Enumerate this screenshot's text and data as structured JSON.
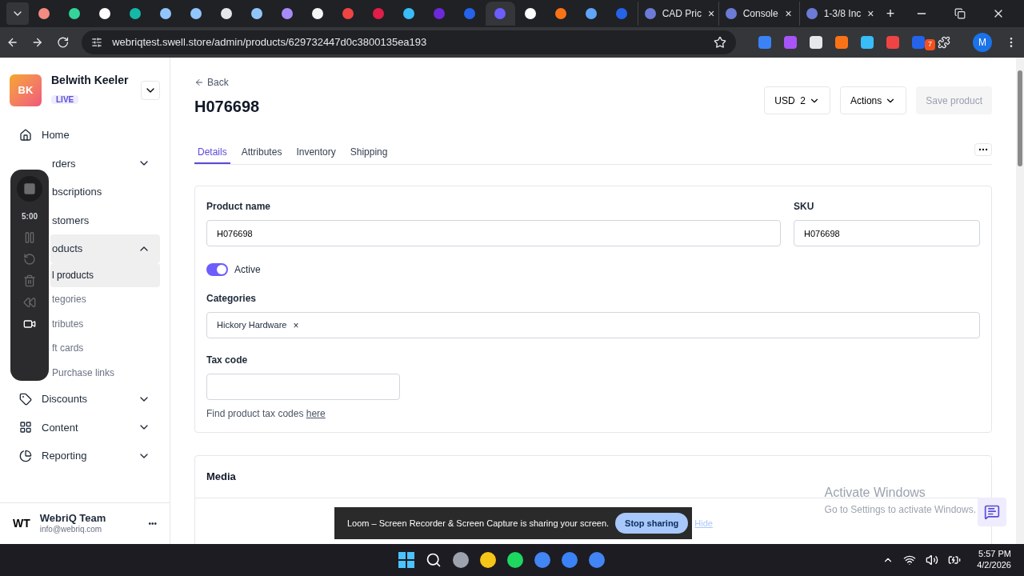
{
  "browser": {
    "pinned_tabs": [
      {
        "color": "#f28b82",
        "selected": false
      },
      {
        "color": "#34d399",
        "selected": false
      },
      {
        "color": "#ffffff",
        "selected": false
      },
      {
        "color": "#14b8a6",
        "selected": false
      },
      {
        "color": "#93c5fd",
        "selected": false
      },
      {
        "color": "#93c5fd",
        "selected": false
      },
      {
        "color": "#e5e7eb",
        "selected": false
      },
      {
        "color": "#93c5fd",
        "selected": false
      },
      {
        "color": "#a78bfa",
        "selected": false
      },
      {
        "color": "#f5f5f5",
        "selected": false
      },
      {
        "color": "#ef4444",
        "selected": false
      },
      {
        "color": "#e11d48",
        "selected": false
      },
      {
        "color": "#38bdf8",
        "selected": false
      },
      {
        "color": "#6d28d9",
        "selected": false
      },
      {
        "color": "#2563eb",
        "selected": false
      },
      {
        "color": "#6d5dfc",
        "selected": true
      },
      {
        "color": "#ffffff",
        "selected": false
      },
      {
        "color": "#f97316",
        "selected": false
      },
      {
        "color": "#60a5fa",
        "selected": false
      },
      {
        "color": "#2563eb",
        "selected": false
      }
    ],
    "tabs": [
      {
        "title": "CAD Pric",
        "close": "×"
      },
      {
        "title": "Console",
        "close": "×"
      },
      {
        "title": "1-3/8 Inc",
        "close": "×"
      }
    ],
    "new_tab": "+",
    "url": "webriqtest.swell.store/admin/products/629732447d0c3800135ea193",
    "profile": "M",
    "extension_badge": "7"
  },
  "sidebar": {
    "store": {
      "initials": "BK",
      "name": "Belwith Keeler",
      "status": "LIVE"
    },
    "items": [
      {
        "label": "Home"
      },
      {
        "label": "rders",
        "expanded": false
      },
      {
        "label": "bscriptions"
      },
      {
        "label": "stomers"
      },
      {
        "label": "oducts",
        "expanded": true,
        "children": [
          {
            "label": "l products",
            "selected": true
          },
          {
            "label": "tegories",
            "selected": false
          },
          {
            "label": "tributes",
            "selected": false
          },
          {
            "label": "ft cards",
            "selected": false
          },
          {
            "label": "Purchase links",
            "selected": false
          }
        ]
      },
      {
        "label": "Discounts",
        "expanded": false
      },
      {
        "label": "Content",
        "expanded": false
      },
      {
        "label": "Reporting",
        "expanded": false
      }
    ],
    "user": {
      "initials": "WT",
      "name": "WebriQ Team",
      "email": "info@webriq.com",
      "more": "•••"
    }
  },
  "recorder": {
    "time": "5:00"
  },
  "header": {
    "back": "Back",
    "title": "H076698",
    "currency": "USD  2",
    "actions": "Actions",
    "save": "Save product",
    "save_disabled": true
  },
  "tabs": [
    {
      "label": "Details",
      "selected": true
    },
    {
      "label": "Attributes",
      "selected": false
    },
    {
      "label": "Inventory",
      "selected": false
    },
    {
      "label": "Shipping",
      "selected": false
    }
  ],
  "form": {
    "product_name_label": "Product name",
    "product_name": "H076698",
    "sku_label": "SKU",
    "sku": "H076698",
    "active": true,
    "active_label": "Active",
    "categories_label": "Categories",
    "categories": [
      {
        "label": "Hickory Hardware",
        "remove": "×"
      }
    ],
    "tax_label": "Tax code",
    "tax_hint": "Find product tax codes ",
    "tax_link": "here"
  },
  "media": {
    "title": "Media"
  },
  "share_bar": {
    "message": "Loom – Screen Recorder & Screen Capture is sharing your screen.",
    "stop": "Stop sharing",
    "hide": "Hide"
  },
  "activation": {
    "title": "Activate Windows",
    "text": "Go to Settings to activate Windows."
  },
  "taskbar": {
    "time": "5:57 PM",
    "date": "4/2/2026"
  }
}
